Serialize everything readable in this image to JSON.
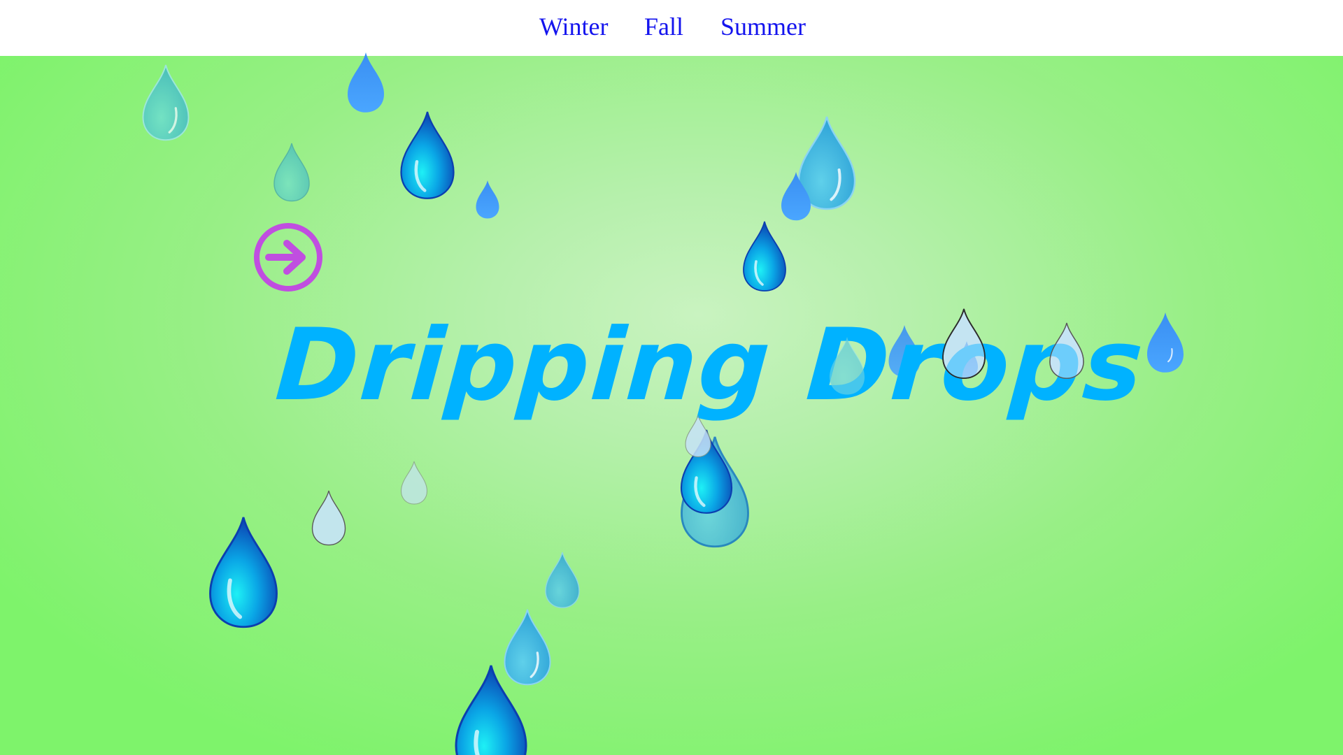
{
  "nav": {
    "items": [
      {
        "label": "Winter"
      },
      {
        "label": "Fall"
      },
      {
        "label": "Summer"
      }
    ]
  },
  "hero": {
    "title": "Dripping Drops",
    "next_icon": "arrow-right-circle-icon"
  },
  "colors": {
    "nav_link": "#1414ee",
    "title": "#00b2ff",
    "arrow": "#c04ee0",
    "background_center": "#c9f3c0",
    "background_edge": "#7ef36b"
  },
  "icons": {
    "drop": "water-drop-icon"
  }
}
